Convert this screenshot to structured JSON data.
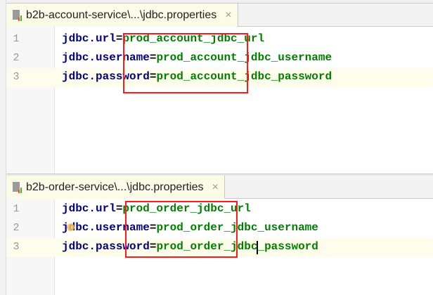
{
  "panes": [
    {
      "tab": {
        "title": "b2b-account-service\\...\\jdbc.properties",
        "icon": "properties-file-icon",
        "close": "×"
      },
      "lines": [
        {
          "num": "1",
          "key": "jdbc.url",
          "eq": "=",
          "value": "prod_account_jdbc_url"
        },
        {
          "num": "2",
          "key": "jdbc.username",
          "eq": "=",
          "value": "prod_account_jdbc_username"
        },
        {
          "num": "3",
          "key": "jdbc.password",
          "eq": "=",
          "value": "prod_account_jdbc_password"
        }
      ]
    },
    {
      "tab": {
        "title": "b2b-order-service\\...\\jdbc.properties",
        "icon": "properties-file-icon",
        "close": "×"
      },
      "lines": [
        {
          "num": "1",
          "key": "jdbc.url",
          "eq": "=",
          "value": "prod_order_jdbc_url"
        },
        {
          "num": "2",
          "key": "jdbc.username",
          "eq": "=",
          "value": "prod_order_jdbc_username"
        },
        {
          "num": "3",
          "key": "jdbc.password",
          "eq": "=",
          "value": "prod_order_jdbc_password"
        }
      ]
    }
  ],
  "colors": {
    "key": "#000080",
    "value": "#007f00",
    "highlight": "#ff1a1a"
  }
}
